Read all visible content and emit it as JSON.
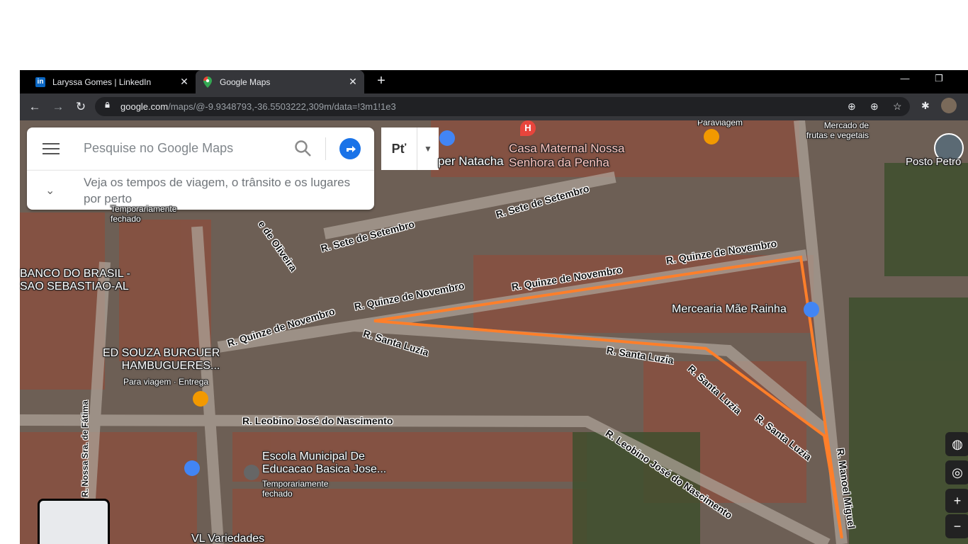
{
  "browser": {
    "tabs": [
      {
        "title": "Laryssa Gomes | LinkedIn",
        "favicon": "linkedin-icon",
        "active": false
      },
      {
        "title": "Google Maps",
        "favicon": "google-maps-icon",
        "active": true
      }
    ],
    "url_host": "google.com",
    "url_path": "/maps/@-9.9348793,-36.5503222,309m/data=!3m1!1e3",
    "window_controls": {
      "minimize": "—",
      "restore": "❐"
    }
  },
  "search": {
    "placeholder": "Pesquise no Google Maps",
    "hint": "Veja os tempos de viagem, o trânsito e os lugares por perto",
    "filter_label": "Pť"
  },
  "places": [
    {
      "name": "Casa Maternal Nossa\nSenhora da Penha",
      "icon": "hospital-icon"
    },
    {
      "name": "per Natacha",
      "icon": "shopping-icon"
    },
    {
      "name": "Paraviagem",
      "icon": "restaurant-icon"
    },
    {
      "name": "Mercado de\nfrutas e vegetais"
    },
    {
      "name": "Posto Petro"
    },
    {
      "name": "BANCO DO BRASIL -\nSAO SEBASTIAO-AL"
    },
    {
      "name": "ED SOUZA BURGUER\nHAMBUGUERES..."
    },
    {
      "name": "Para viagem · Entrega"
    },
    {
      "name": "Mercearia Mãe Rainha",
      "icon": "shopping-icon"
    },
    {
      "name": "Escola Municipal De\nEducacao Basica Jose..."
    },
    {
      "name": "Temporariamente\nfechado"
    },
    {
      "name": "Temporariamente\nfechado"
    },
    {
      "name": "VL Variedades"
    }
  ],
  "streets": [
    "R. Sete de Setembro",
    "R. Sete de Setembro",
    "R. Quinze de Novembro",
    "R. Quinze de Novembro",
    "R. Quinze de Novembro",
    "R. Quinze de Novembro",
    "R. Santa Luzia",
    "R. Santa Luzia",
    "R. Santa Luzia",
    "R. Santa Luzia",
    "R. Leobino José do Nascimento",
    "R. Leobino José do Nascimento",
    "R. Nossa Sra. de Fátima",
    "R. Manoel Miguel",
    "e de Oliveira"
  ],
  "controls": [
    "globe-icon",
    "locate-icon",
    "zoom-in-icon",
    "zoom-out-icon"
  ],
  "colors": {
    "route": "#ff7f2a",
    "tab_bar": "#000000",
    "toolbar": "#35363a"
  }
}
